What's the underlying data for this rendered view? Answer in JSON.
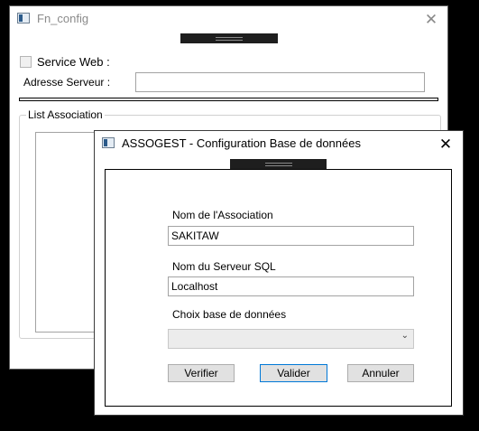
{
  "back_window": {
    "title": "Fn_config",
    "service_web_label": "Service Web :",
    "service_web_checked": false,
    "adresse_label": "Adresse Serveur :",
    "adresse_value": "",
    "group_label": "List Association"
  },
  "dialog": {
    "title": "ASSOGEST - Configuration Base de données",
    "nom_association_label": "Nom de l'Association",
    "nom_association_value": "SAKITAW",
    "nom_serveur_label": "Nom du Serveur SQL",
    "nom_serveur_value": "Localhost",
    "choix_base_label": "Choix base de données",
    "choix_base_value": "",
    "buttons": {
      "verifier": "Verifier",
      "valider": "Valider",
      "annuler": "Annuler"
    }
  },
  "icons": {
    "close": "close-icon",
    "dropdown": "chevron-down-icon",
    "app": "app-icon"
  }
}
